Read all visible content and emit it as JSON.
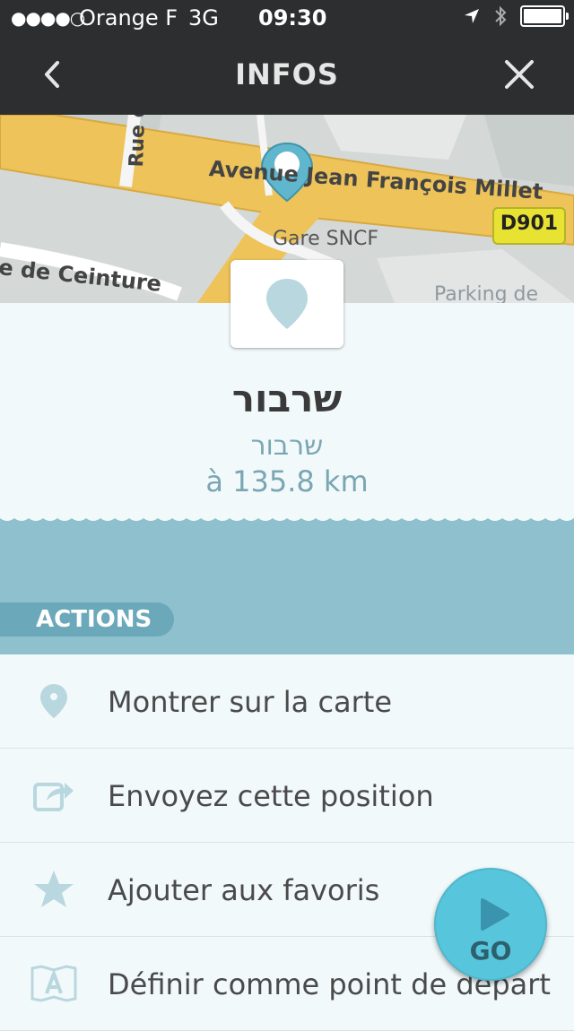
{
  "status_bar": {
    "signal_dots": "●●●●○",
    "carrier": "Orange F",
    "network": "3G",
    "time": "09:30"
  },
  "nav": {
    "title": "INFOS",
    "back_icon": "chevron-left-icon",
    "close_icon": "close-icon"
  },
  "map": {
    "street_top": "Avenue Jean François Millet",
    "street_left": "Rue d",
    "station": "Gare SNCF",
    "street_bottom": "e de Ceinture",
    "parking": "Parking de",
    "road_badge": "D901"
  },
  "place": {
    "name": "שרבור",
    "subname": "שרבור",
    "distance": "à 135.8 km"
  },
  "actions": {
    "header": "ACTIONS",
    "items": [
      {
        "label": "Montrer sur la carte",
        "icon": "map-pin-icon"
      },
      {
        "label": "Envoyez cette position",
        "icon": "share-icon"
      },
      {
        "label": "Ajouter aux favoris",
        "icon": "star-icon"
      },
      {
        "label": "Définir comme point de départ",
        "icon": "start-point-icon"
      }
    ]
  },
  "go_button": {
    "label": "GO",
    "icon": "play-icon"
  },
  "colors": {
    "bar": "#2c2e2f",
    "accent": "#57c6dd",
    "band": "#8ec1cd",
    "label_bg": "#6ba9ba",
    "text_muted": "#7aa6b3"
  }
}
